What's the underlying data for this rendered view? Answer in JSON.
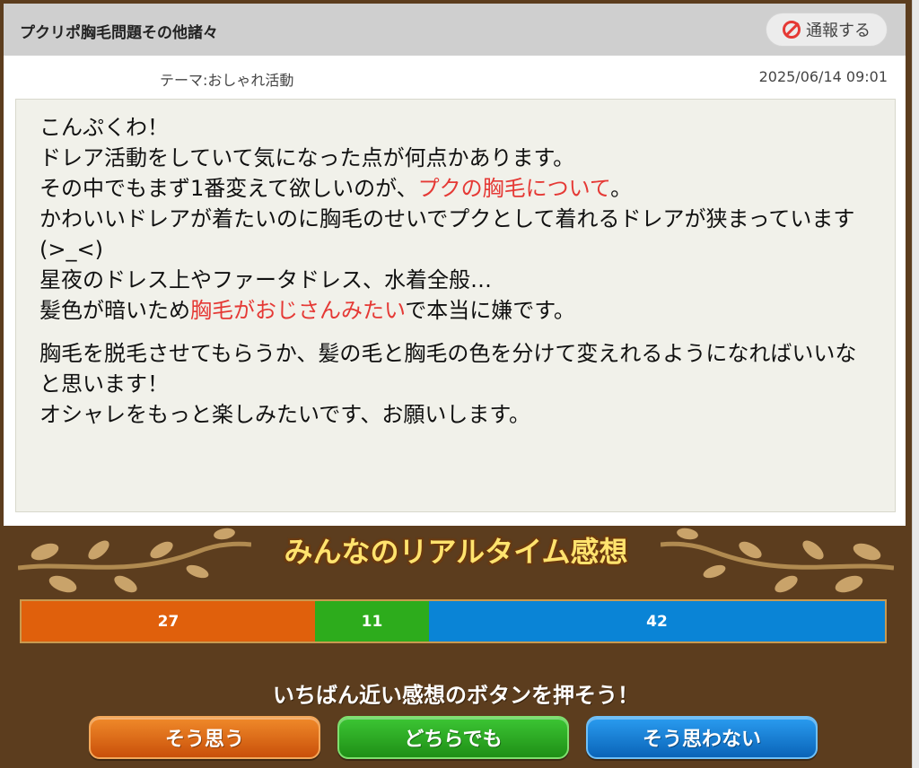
{
  "post": {
    "title": "プクリポ胸毛問題その他諸々",
    "report_label": "通報する",
    "theme": "テーマ:おしゃれ活動",
    "datetime": "2025/06/14 09:01",
    "line1": "こんぷくわ！",
    "line2": "ドレア活動をしていて気になった点が何点かあります。",
    "line3_pre": "その中でもまず1番変えて欲しいのが、",
    "line3_red": "プクの胸毛について",
    "line3_post": "。",
    "line4": "かわいいドレアが着たいのに胸毛のせいでプクとして着れるドレアが狭まっています(>_<)",
    "line5": "星夜のドレス上やファータドレス、水着全般…",
    "line6_pre": "髪色が暗いため",
    "line6_red": "胸毛がおじさんみたい",
    "line6_post": "で本当に嫌です。",
    "para2_line1": "胸毛を脱毛させてもらうか、髪の毛と胸毛の色を分けて変えれるようになればいいなと思います！",
    "para2_line2": "オシャレをもっと楽しみたいです、お願いします。"
  },
  "realtime": {
    "title": "みんなのリアルタイム感想",
    "agree_count": "27",
    "either_count": "11",
    "disagree_count": "42",
    "prompt": "いちばん近い感想のボタンを押そう！",
    "agree_label": "そう思う",
    "either_label": "どちらでも",
    "disagree_label": "そう思わない"
  },
  "colors": {
    "agree": "#e0600c",
    "either": "#2dac1c",
    "disagree": "#0a84d6",
    "highlight": "#e53935"
  },
  "icons": {
    "report": "ban-icon",
    "branch": "leaf-branch-icon"
  }
}
